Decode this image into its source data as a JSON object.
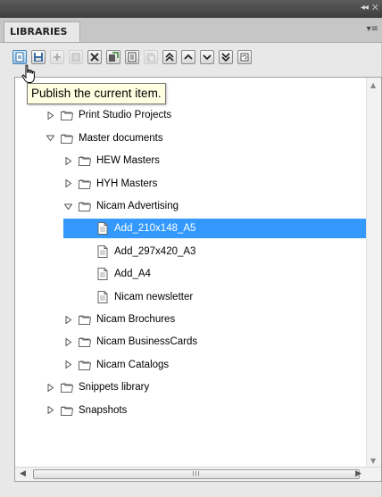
{
  "window": {
    "collapse_glyph": "◂◂",
    "close_glyph": "✕"
  },
  "panel": {
    "tab_label": "LIBRARIES",
    "menu_glyph": "▾≡"
  },
  "toolbar": {
    "buttons": [
      {
        "icon": "publish-icon",
        "state": "active"
      },
      {
        "icon": "save-icon",
        "state": "normal"
      },
      {
        "icon": "add-icon",
        "state": "disabled"
      },
      {
        "icon": "edit-icon",
        "state": "disabled"
      },
      {
        "icon": "delete-icon",
        "state": "normal"
      },
      {
        "icon": "import-icon",
        "state": "normal"
      },
      {
        "icon": "properties-icon",
        "state": "normal"
      },
      {
        "icon": "copy-icon",
        "state": "disabled"
      },
      {
        "icon": "move-top-icon",
        "state": "normal"
      },
      {
        "icon": "move-up-icon",
        "state": "normal"
      },
      {
        "icon": "move-down-icon",
        "state": "normal"
      },
      {
        "icon": "move-bottom-icon",
        "state": "normal"
      },
      {
        "icon": "refresh-icon",
        "state": "normal"
      }
    ]
  },
  "tooltip": {
    "text": "Publish the current item."
  },
  "tree": {
    "items": [
      {
        "label": "",
        "type": "root",
        "level": 0,
        "expanded": true
      },
      {
        "label": "Print Studio Projects",
        "type": "folder",
        "level": 1,
        "expanded": false
      },
      {
        "label": "Master documents",
        "type": "folder",
        "level": 1,
        "expanded": true
      },
      {
        "label": "HEW Masters",
        "type": "folder",
        "level": 2,
        "expanded": false
      },
      {
        "label": "HYH Masters",
        "type": "folder",
        "level": 2,
        "expanded": false
      },
      {
        "label": "Nicam Advertising",
        "type": "folder",
        "level": 2,
        "expanded": true
      },
      {
        "label": "Add_210x148_A5",
        "type": "document",
        "level": 3,
        "selected": true
      },
      {
        "label": "Add_297x420_A3",
        "type": "document",
        "level": 3
      },
      {
        "label": "Add_A4",
        "type": "document",
        "level": 3
      },
      {
        "label": "Nicam newsletter",
        "type": "document",
        "level": 3
      },
      {
        "label": "Nicam Brochures",
        "type": "folder",
        "level": 2,
        "expanded": false
      },
      {
        "label": "Nicam BusinessCards",
        "type": "folder",
        "level": 2,
        "expanded": false
      },
      {
        "label": "Nicam Catalogs",
        "type": "folder",
        "level": 2,
        "expanded": false
      },
      {
        "label": "Snippets library",
        "type": "folder",
        "level": 1,
        "expanded": false
      },
      {
        "label": "Snapshots",
        "type": "folder",
        "level": 1,
        "expanded": false
      }
    ]
  },
  "scrollbar": {
    "up_glyph": "▲",
    "down_glyph": "▼",
    "left_glyph": "◀",
    "right_glyph": "▶",
    "grip_glyph": "III"
  },
  "colors": {
    "selection": "#3399ff",
    "tooltip_bg": "#ffffe1"
  }
}
